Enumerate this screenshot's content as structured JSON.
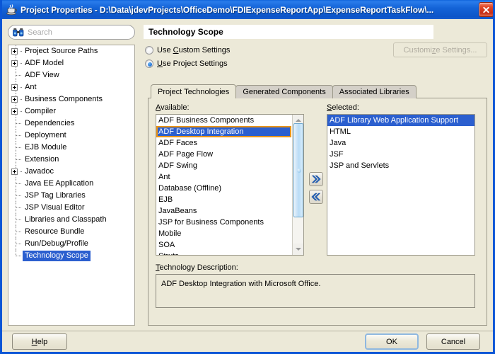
{
  "window": {
    "title": "Project Properties - D:\\Data\\jdevProjects\\OfficeDemo\\FDIExpenseReportApp\\ExpenseReportTaskFlow\\...",
    "app_icon": "java-coffee-cup-icon",
    "close_label": "✕"
  },
  "sidebar": {
    "search": {
      "placeholder": "Search",
      "value": "",
      "icon": "binoculars-icon"
    },
    "items": [
      {
        "label": "Project Source Paths",
        "expandable": true,
        "selected": false
      },
      {
        "label": "ADF Model",
        "expandable": true,
        "selected": false
      },
      {
        "label": "ADF View",
        "expandable": false,
        "selected": false
      },
      {
        "label": "Ant",
        "expandable": true,
        "selected": false
      },
      {
        "label": "Business Components",
        "expandable": true,
        "selected": false
      },
      {
        "label": "Compiler",
        "expandable": true,
        "selected": false
      },
      {
        "label": "Dependencies",
        "expandable": false,
        "selected": false
      },
      {
        "label": "Deployment",
        "expandable": false,
        "selected": false
      },
      {
        "label": "EJB Module",
        "expandable": false,
        "selected": false
      },
      {
        "label": "Extension",
        "expandable": false,
        "selected": false
      },
      {
        "label": "Javadoc",
        "expandable": true,
        "selected": false
      },
      {
        "label": "Java EE Application",
        "expandable": false,
        "selected": false
      },
      {
        "label": "JSP Tag Libraries",
        "expandable": false,
        "selected": false
      },
      {
        "label": "JSP Visual Editor",
        "expandable": false,
        "selected": false
      },
      {
        "label": "Libraries and Classpath",
        "expandable": false,
        "selected": false
      },
      {
        "label": "Resource Bundle",
        "expandable": false,
        "selected": false
      },
      {
        "label": "Run/Debug/Profile",
        "expandable": false,
        "selected": false
      },
      {
        "label": "Technology Scope",
        "expandable": false,
        "selected": true
      }
    ]
  },
  "main": {
    "page_title": "Technology Scope",
    "settings_mode": {
      "custom": {
        "label": "Use Custom Settings",
        "mnemonic": "C",
        "checked": false
      },
      "project": {
        "label": "Use Project Settings",
        "mnemonic": "U",
        "checked": true
      }
    },
    "customize_button": {
      "label": "Customize Settings...",
      "enabled": false
    },
    "tabs": [
      {
        "label": "Project Technologies",
        "active": true
      },
      {
        "label": "Generated Components",
        "active": false
      },
      {
        "label": "Associated Libraries",
        "active": false
      }
    ],
    "available": {
      "caption": "Available:",
      "mnemonic": "A",
      "items": [
        {
          "label": "ADF Business Components",
          "selected": false
        },
        {
          "label": "ADF Desktop Integration",
          "selected": true
        },
        {
          "label": "ADF Faces",
          "selected": false
        },
        {
          "label": "ADF Page Flow",
          "selected": false
        },
        {
          "label": "ADF Swing",
          "selected": false
        },
        {
          "label": "Ant",
          "selected": false
        },
        {
          "label": "Database (Offline)",
          "selected": false
        },
        {
          "label": "EJB",
          "selected": false
        },
        {
          "label": "JavaBeans",
          "selected": false
        },
        {
          "label": "JSP for Business Components",
          "selected": false
        },
        {
          "label": "Mobile",
          "selected": false
        },
        {
          "label": "SOA",
          "selected": false
        },
        {
          "label": "Struts",
          "selected": false
        }
      ]
    },
    "selected_list": {
      "caption": "Selected:",
      "mnemonic": "S",
      "items": [
        {
          "label": "ADF Library Web Application Support",
          "selected": true
        },
        {
          "label": "HTML",
          "selected": false
        },
        {
          "label": "Java",
          "selected": false
        },
        {
          "label": "JSF",
          "selected": false
        },
        {
          "label": "JSP and Servlets",
          "selected": false
        }
      ]
    },
    "transfer": {
      "add_label": "»",
      "add_name": "move-right-button",
      "remove_label": "«",
      "remove_name": "move-left-button"
    },
    "description": {
      "caption": "Technology Description:",
      "mnemonic": "T",
      "text": "ADF Desktop Integration with Microsoft Office."
    }
  },
  "footer": {
    "help": "Help",
    "ok": "OK",
    "cancel": "Cancel"
  },
  "colors": {
    "title_bar": "#1464d8",
    "selection": "#2b5fcf",
    "focus_ring": "#e8941a",
    "dialog_bg": "#ece9d8",
    "close_button": "#c62d16"
  }
}
